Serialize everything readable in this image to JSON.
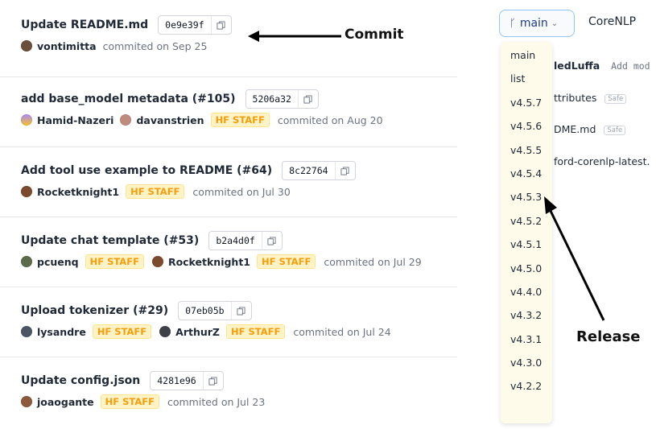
{
  "commits": [
    {
      "title": "Update README.md",
      "sha": "0e9e39f",
      "authors": [
        {
          "name": "vontimitta",
          "staff": false,
          "avatar_color": "#6b4f3a"
        }
      ],
      "date": "commited on Sep 25"
    },
    {
      "title": "add base_model metadata (#105)",
      "sha": "5206a32",
      "authors": [
        {
          "name": "Hamid-Nazeri",
          "staff": false,
          "avatar_color": "#a78bfa"
        },
        {
          "name": "davanstrien",
          "staff": true,
          "avatar_color": "#c08a7d"
        }
      ],
      "date": "commited on Aug 20"
    },
    {
      "title": "Add tool use example to README (#64)",
      "sha": "8c22764",
      "authors": [
        {
          "name": "Rocketknight1",
          "staff": true,
          "avatar_color": "#7c4a2d"
        }
      ],
      "date": "commited on Jul 30"
    },
    {
      "title": "Update chat template (#53)",
      "sha": "b2a4d0f",
      "authors": [
        {
          "name": "pcuenq",
          "staff": true,
          "avatar_color": "#5b6b4a"
        },
        {
          "name": "Rocketknight1",
          "staff": true,
          "avatar_color": "#7c4a2d"
        }
      ],
      "date": "commited on Jul 29"
    },
    {
      "title": "Upload tokenizer (#29)",
      "sha": "07eb05b",
      "authors": [
        {
          "name": "lysandre",
          "staff": true,
          "avatar_color": "#4b5563"
        },
        {
          "name": "ArthurZ",
          "staff": true,
          "avatar_color": "#3f3f46"
        }
      ],
      "date": "commited on Jul 24"
    },
    {
      "title": "Update config.json",
      "sha": "4281e96",
      "authors": [
        {
          "name": "joaogante",
          "staff": true,
          "avatar_color": "#8b5a3c"
        }
      ],
      "date": "commited on Jul 23"
    }
  ],
  "staff_label": "HF STAFF",
  "annotations": {
    "commit": "Commit",
    "release": "Release"
  },
  "branch": {
    "current": "main",
    "icon": "branch-icon"
  },
  "repo_name": "CoreNLP",
  "file_rows": [
    {
      "text": "ledLuffa",
      "extra": "Add mod",
      "safe": ""
    },
    {
      "text": "ttributes",
      "extra": "",
      "safe": "Safe"
    },
    {
      "text": "DME.md",
      "extra": "",
      "safe": "Safe"
    },
    {
      "text": "ford-corenlp-latest.",
      "extra": "",
      "safe": ""
    }
  ],
  "dropdown_options": [
    "main",
    "list",
    "v4.5.7",
    "v4.5.6",
    "v4.5.5",
    "v4.5.4",
    "v4.5.3",
    "v4.5.2",
    "v4.5.1",
    "v4.5.0",
    "v4.4.0",
    "v4.3.2",
    "v4.3.1",
    "v4.3.0",
    "v4.2.2"
  ],
  "colors": {
    "staff_bg": "#fef3c7",
    "staff_text": "#f59e0b",
    "dropdown_bg": "#fffbeb",
    "branch_border": "#93c5fd"
  }
}
